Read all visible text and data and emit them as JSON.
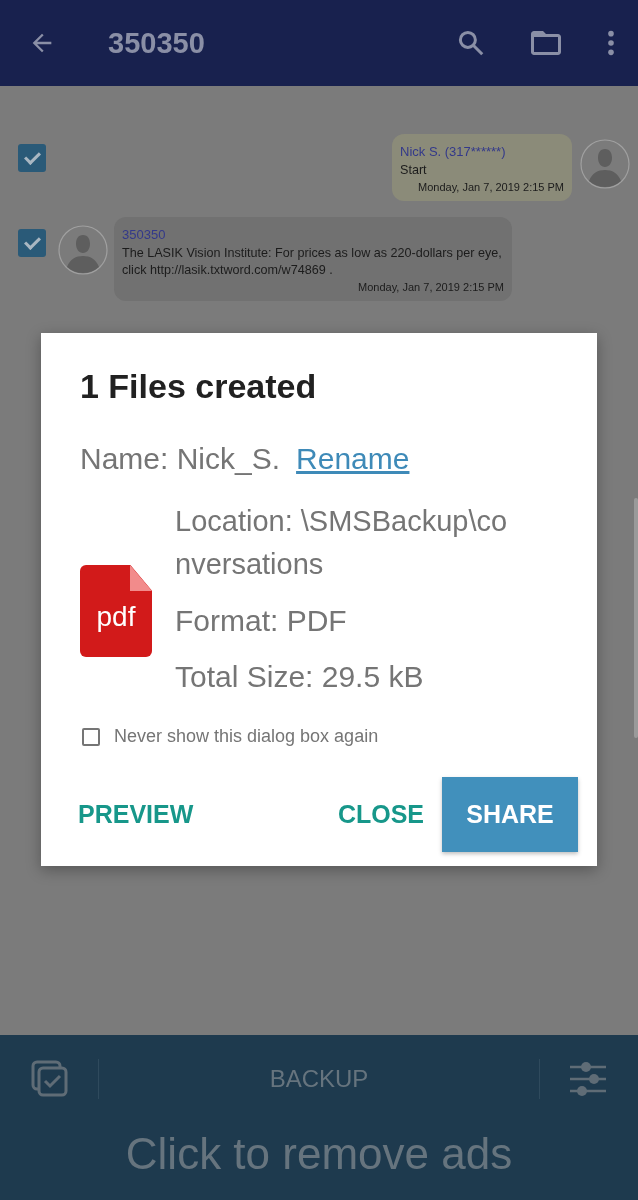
{
  "app_bar": {
    "title": "350350"
  },
  "messages": [
    {
      "kind": "outgoing",
      "checked": true,
      "sender": "Nick S. (317******)",
      "text": "Start",
      "time": "Monday, Jan 7, 2019 2:15 PM"
    },
    {
      "kind": "incoming",
      "checked": true,
      "sender": "350350",
      "text": "The LASIK Vision Institute: For prices as low as 220-dollars per eye, click http://lasik.txtword.com/w74869 .",
      "time": "Monday, Jan 7, 2019 2:15 PM"
    }
  ],
  "dialog": {
    "title": "1 Files created",
    "name": "Name: Nick_S.",
    "rename_link": "Rename",
    "file_icon_label": "pdf",
    "location_lines": [
      "Location: \\SMSBackup\\co",
      "nversations"
    ],
    "format": "Format: PDF",
    "total_size": "Total Size: 29.5 kB",
    "never_show": {
      "label": "Never show this dialog box again",
      "checked": false
    },
    "buttons": [
      {
        "label": "PREVIEW",
        "kind": "text"
      },
      {
        "label": "CLOSE",
        "kind": "text"
      },
      {
        "label": "SHARE",
        "kind": "filled"
      }
    ]
  },
  "bottom_bar": {
    "backup_label": "BACKUP",
    "ad_text": "Click to remove ads"
  }
}
